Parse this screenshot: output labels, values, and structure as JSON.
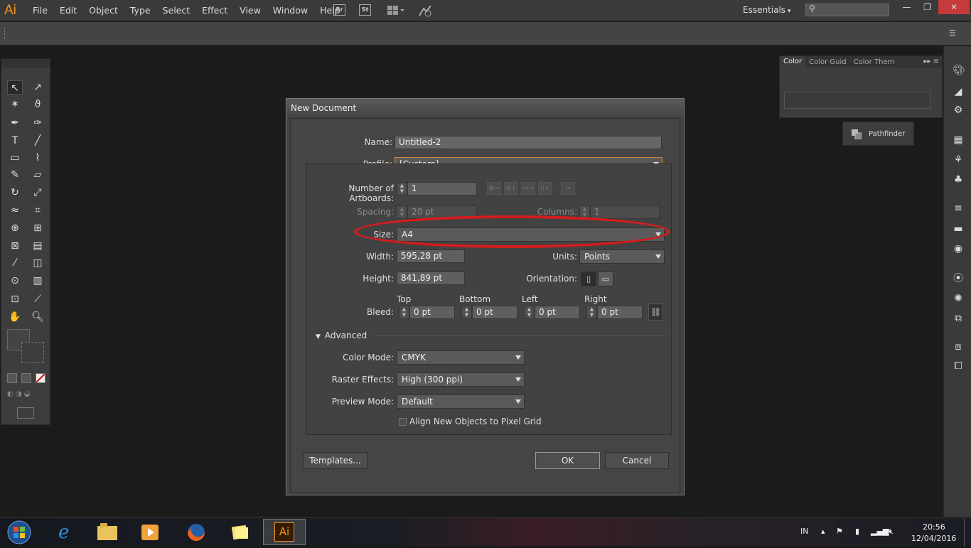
{
  "app": {
    "logo": "Ai",
    "menu": [
      "File",
      "Edit",
      "Object",
      "Type",
      "Select",
      "Effect",
      "View",
      "Window",
      "Help"
    ],
    "bridge_label": "Br",
    "stock_label": "St",
    "workspace": "Essentials",
    "search_placeholder": ""
  },
  "window_controls": {
    "minimize": "—",
    "restore": "❐",
    "close": "✕"
  },
  "color_panel": {
    "tabs": [
      "Color",
      "Color Guid",
      "Color Them"
    ]
  },
  "pathfinder": {
    "label": "Pathfinder"
  },
  "dialog": {
    "title": "New Document",
    "name_label": "Name:",
    "name_value": "Untitled-2",
    "profile_label": "Profile:",
    "profile_value": "[Custom]",
    "artboards_label": "Number of Artboards:",
    "artboards_value": "1",
    "spacing_label": "Spacing:",
    "spacing_value": "20 pt",
    "columns_label": "Columns:",
    "columns_value": "1",
    "size_label": "Size:",
    "size_value": "A4",
    "width_label": "Width:",
    "width_value": "595,28 pt",
    "units_label": "Units:",
    "units_value": "Points",
    "height_label": "Height:",
    "height_value": "841,89 pt",
    "orientation_label": "Orientation:",
    "bleed_label": "Bleed:",
    "bleed_headers": [
      "Top",
      "Bottom",
      "Left",
      "Right"
    ],
    "bleed_values": [
      "0 pt",
      "0 pt",
      "0 pt",
      "0 pt"
    ],
    "advanced_label": "Advanced",
    "color_mode_label": "Color Mode:",
    "color_mode_value": "CMYK",
    "raster_label": "Raster Effects:",
    "raster_value": "High (300 ppi)",
    "preview_label": "Preview Mode:",
    "preview_value": "Default",
    "pixel_grid_label": "Align New Objects to Pixel Grid",
    "pixel_grid_checked": false,
    "templates_button": "Templates...",
    "ok_button": "OK",
    "cancel_button": "Cancel"
  },
  "taskbar": {
    "language": "IN",
    "time": "20:56",
    "date": "12/04/2016",
    "ai_label": "Ai"
  },
  "colors": {
    "accent": "#f7931e",
    "highlight": "#d31c1c",
    "profile_border": "#d08b3a"
  }
}
